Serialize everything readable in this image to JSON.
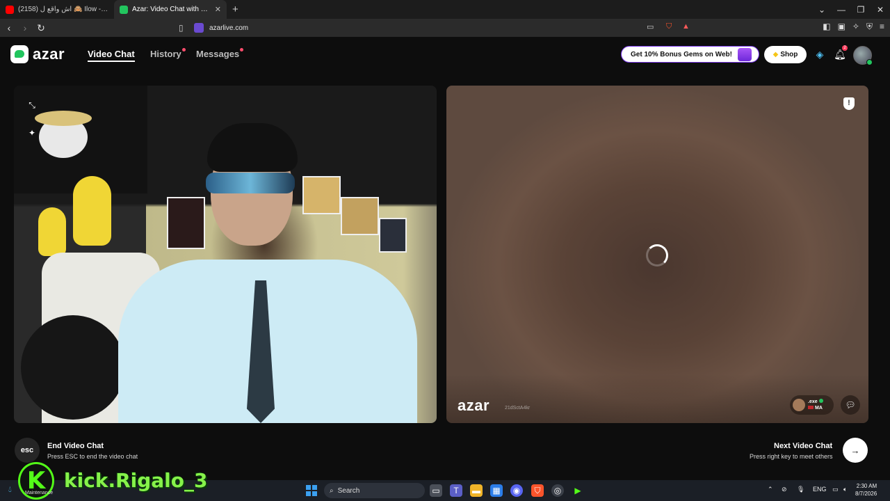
{
  "browser": {
    "tabs": [
      {
        "label": "(2158) اش واقع ل 🙈 Ilow - YouTube",
        "favicon_color": "#ff0000"
      },
      {
        "label": "Azar: Video Chat with New People",
        "favicon_color": "#22c55e"
      }
    ],
    "new_tab": "+",
    "url": "azarlive.com"
  },
  "app": {
    "logo": "azar",
    "nav": {
      "video_chat": "Video Chat",
      "history": "History",
      "messages": "Messages"
    },
    "bonus_label": "Get 10% Bonus Gems on Web!",
    "shop_label": "Shop",
    "notification_count": "2"
  },
  "remote_video": {
    "watermark": "azar",
    "watermark_id": "21dSctA4kr",
    "peer_name": ".exe",
    "peer_country": "MA"
  },
  "controls": {
    "esc_key": "esc",
    "end_title": "End Video Chat",
    "end_sub": "Press ESC to end the video chat",
    "next_title": "Next Video Chat",
    "next_sub": "Press right key to meet others"
  },
  "overlay": {
    "kick_letter": "K",
    "kick_handle": "kick.Rigalo_3",
    "kick_sub": "Maintenance"
  },
  "taskbar": {
    "search_label": "Search",
    "language": "ENG",
    "time": "2:30 AM",
    "date": "8/7/2026"
  },
  "colors": {
    "accent": "#22c55e",
    "kick_green": "#53fc18",
    "bonus_border": "#7c3aed"
  }
}
